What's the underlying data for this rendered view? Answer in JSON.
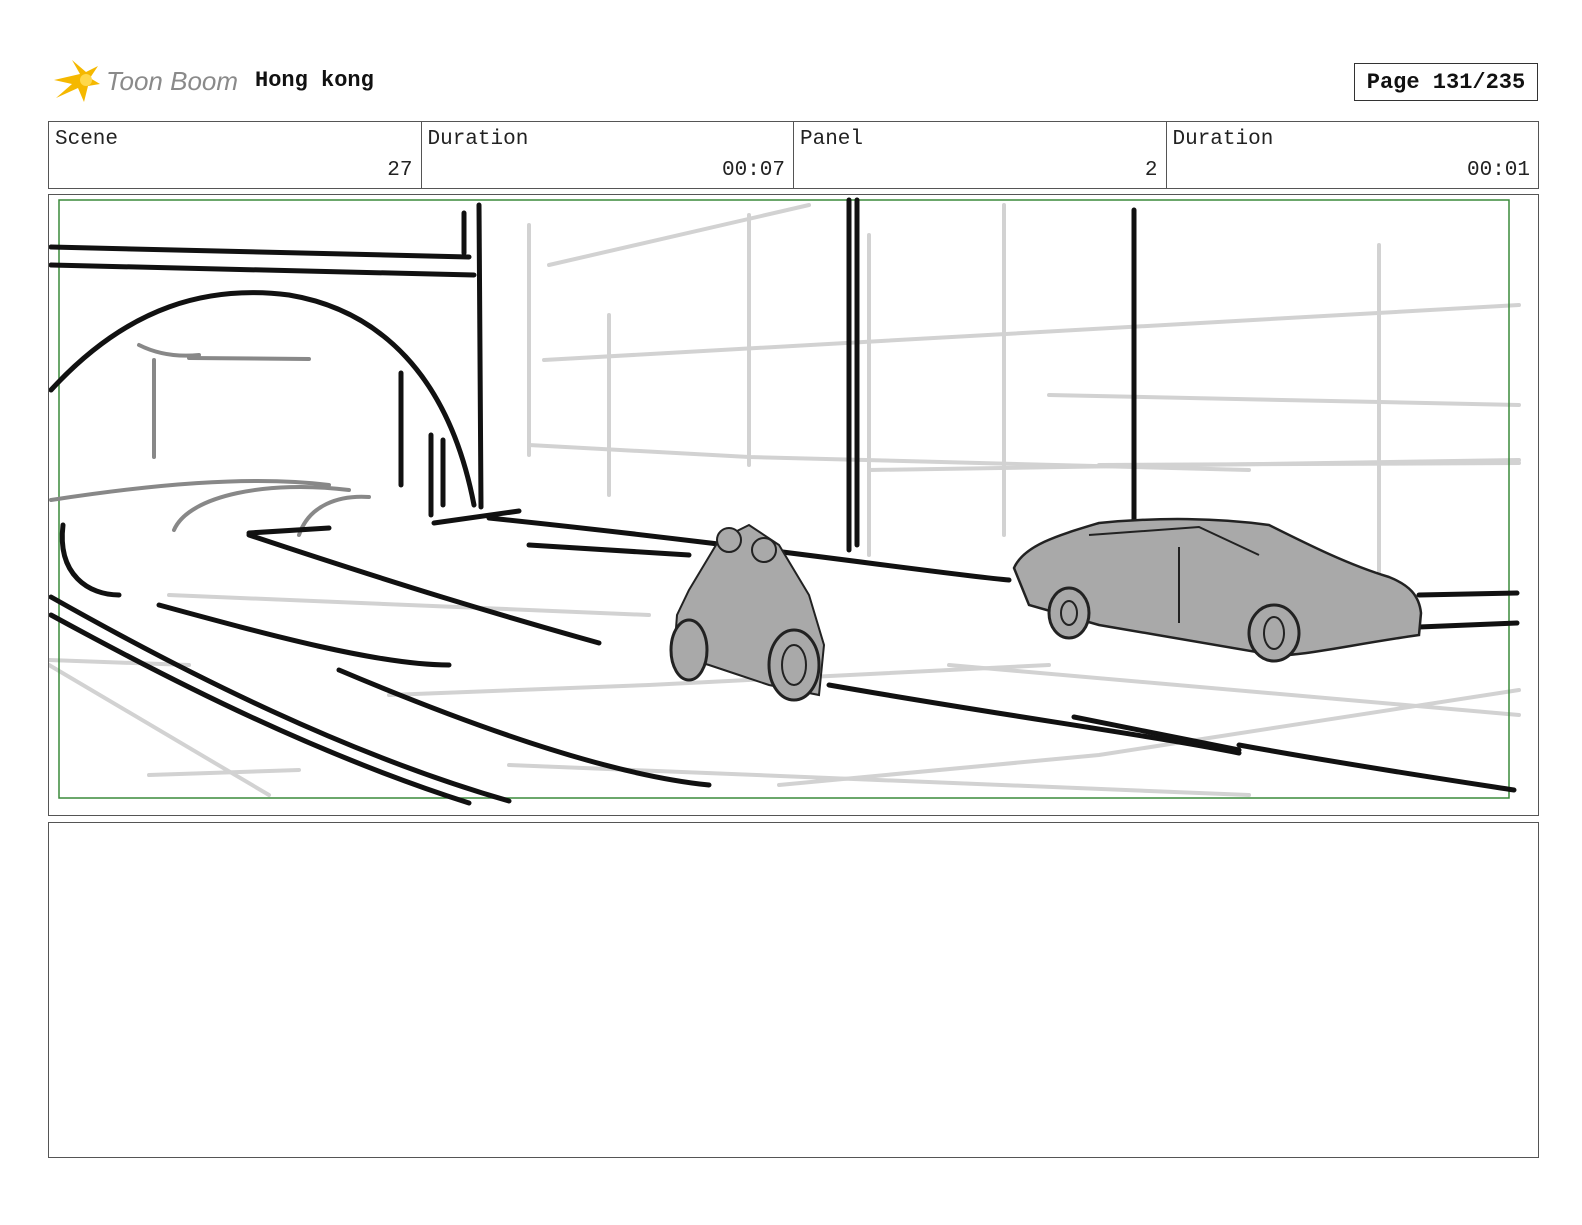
{
  "header": {
    "logo_text": "Toon Boom",
    "project_title": "Hong kong",
    "page_label": "Page 131/235"
  },
  "info_bar": {
    "cells": [
      {
        "label": "Scene",
        "value": "27"
      },
      {
        "label": "Duration",
        "value": "00:07"
      },
      {
        "label": "Panel",
        "value": "2"
      },
      {
        "label": "Duration",
        "value": "00:01"
      }
    ]
  },
  "colors": {
    "logo_star": "#f5b800",
    "logo_text": "#8a8a8a",
    "safe_frame": "#3a8a3a",
    "vehicle_fill": "#a9a9a9",
    "sketch_line": "#111111",
    "sketch_light": "#cfcfcf"
  },
  "notes": {
    "text": ""
  }
}
